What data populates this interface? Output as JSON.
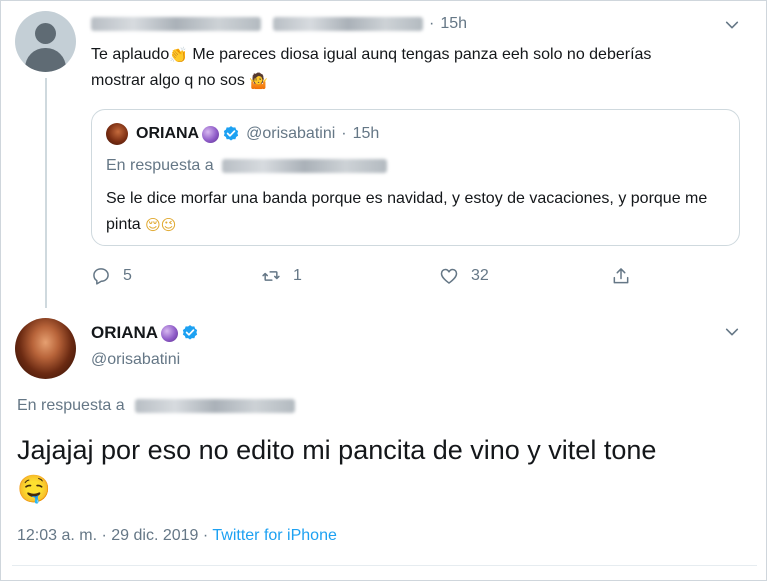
{
  "reply_tweet": {
    "time": "15h",
    "text_before": "Te aplaudo",
    "text_emoji_clap": "👏",
    "text_after": " Me pareces diosa igual aunq tengas panza eeh solo no deberías mostrar algo q no sos",
    "text_emoji_end": "🤷",
    "actions": {
      "replies": "5",
      "retweets": "1",
      "likes": "32"
    }
  },
  "quoted_tweet": {
    "name": "ORIANA",
    "handle": "@orisabatini",
    "time": "15h",
    "reply_label": "En respuesta a",
    "text": "Se le dice morfar una banda porque es navidad, y estoy de vacaciones, y porque me pinta",
    "emojis": "😌😉"
  },
  "main_tweet": {
    "name": "ORIANA",
    "handle": "@orisabatini",
    "reply_label": "En respuesta a",
    "text": "Jajajaj por eso no edito mi pancita de vino y vitel tone",
    "emoji": "🤤",
    "timestamp": "12:03 a. m. · 29 dic. 2019 · ",
    "source": "Twitter for iPhone"
  },
  "colors": {
    "accent": "#1da1f2",
    "secondary_text": "#657786",
    "border": "#cfd9de"
  },
  "icons": [
    "reply-icon",
    "retweet-icon",
    "like-icon",
    "share-icon",
    "chevron-down-icon",
    "verified-badge-icon",
    "crystal-ball-icon"
  ]
}
